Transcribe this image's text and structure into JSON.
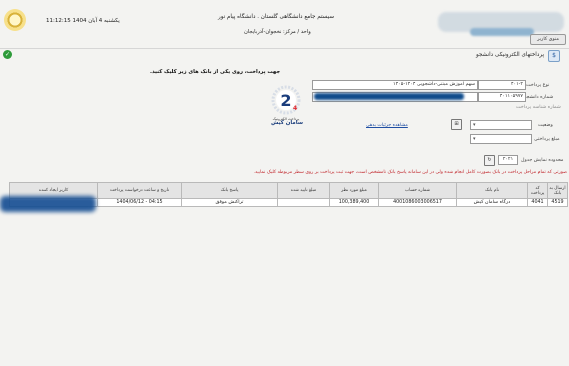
{
  "header": {
    "date_text": "11:12:15 یکشنبه 4 آبان 1404",
    "title": "سیستم جامع دانشگاهی گلستان . دانشگاه پیام نور",
    "unit": "واحد / مرکز: نخجوان-آذربایجان",
    "menu_label": "منوی کاربر"
  },
  "page": {
    "title": "پرداختهای الکترونیکی دانشجو",
    "instruction": "جهت پرداخت، روی یکی از بانک های زیر کلیک کنید."
  },
  "form": {
    "payment_type_label": "نوع پرداخت",
    "payment_type_code": "۴۰۱-۲",
    "payment_type_desc": "سهم آموزش مبتنی-داشجویی ۱۴۰۴-۱۴۰۵",
    "student_number_label": "شماره دانشجو",
    "student_number": "۴۰۱۱۰۵۹۷۷",
    "payment_id_label": "شماره شناسه پرداخت",
    "status_label": "وضعیت",
    "amount_label": "مبلغ پرداختی",
    "details_link": "مشاهده جزئیات بدهی",
    "limit_label": "محدوده نمایش جدول",
    "limit_value": "۲۰۲۱"
  },
  "bank": {
    "name": "سامان کیش",
    "caption": "پرداخت الکترونیک"
  },
  "table": {
    "warning": "صورتی که تمام مراحل پرداخت در بانک بصورت کامل انجام شده ولی در این سامانه پاسخ بانک نامشخص است، جهت ثبت پرداخت بر روی سطر مربوطه کلیک نمایید.",
    "columns": [
      "ارسال به بانک",
      "کد پرداخت",
      "نام بانک",
      "شماره حساب",
      "مبلغ مورد نظر",
      "مبلغ تایید شده",
      "پاسخ بانک",
      "تاریخ و ساعت درخواست پرداخت",
      "کاربر ایجاد کننده"
    ],
    "rows": [
      [
        "4519",
        "4041",
        "درگاه سامان کیش",
        "4001086003006517",
        "100,389,400",
        "",
        "تراکنش موفق",
        "1404/06/12 - 04:15",
        ""
      ]
    ]
  }
}
